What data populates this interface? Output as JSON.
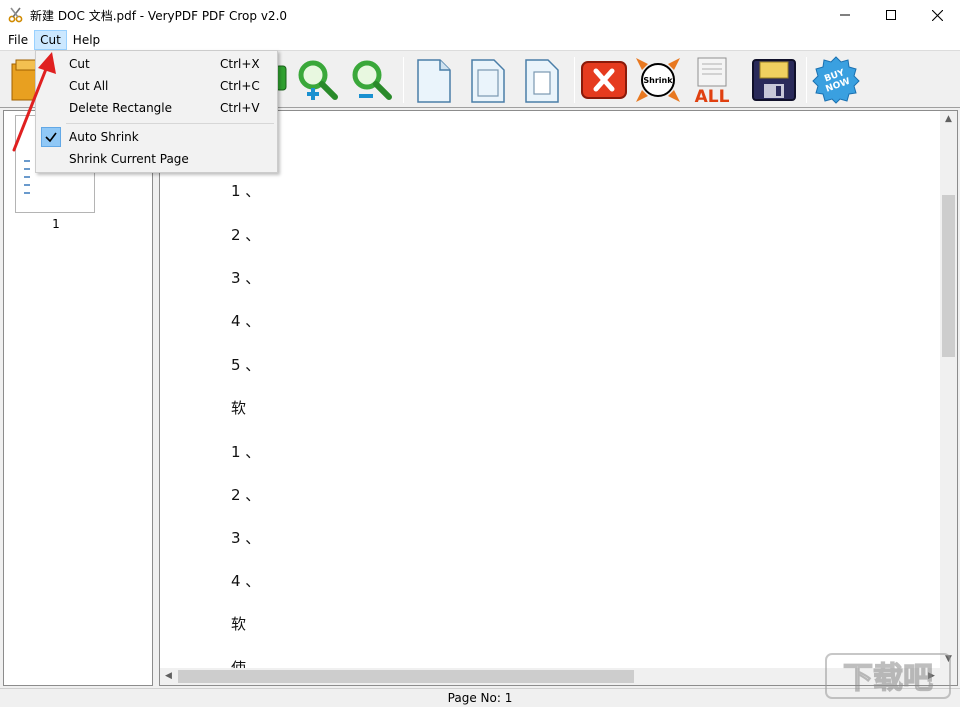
{
  "window": {
    "title": "新建 DOC 文档.pdf - VeryPDF PDF Crop v2.0",
    "app_icon": "scissors-icon",
    "controls": [
      "minimize-icon",
      "maximize-icon",
      "close-icon"
    ]
  },
  "menubar": {
    "items": [
      {
        "label": "File"
      },
      {
        "label": "Cut"
      },
      {
        "label": "Help"
      }
    ]
  },
  "cut_menu": {
    "items": [
      {
        "label": "Cut",
        "shortcut": "Ctrl+X"
      },
      {
        "label": "Cut All",
        "shortcut": "Ctrl+C"
      },
      {
        "label": "Delete Rectangle",
        "shortcut": "Ctrl+V"
      },
      {
        "label": "Auto Shrink",
        "checked": true
      },
      {
        "label": "Shrink Current Page"
      }
    ]
  },
  "toolbar": {
    "buttons": [
      "open-icon",
      "zoom-in-icon",
      "zoom-out-icon",
      "page-icon",
      "page-frame-icon",
      "page-crop-icon",
      "delete-icon",
      "shrink-icon",
      "all-icon",
      "save-icon",
      "buy-now-icon"
    ],
    "shrink_label": "Shrink",
    "all_label": "ALL",
    "buy_label_1": "BUY",
    "buy_label_2": "NOW"
  },
  "thumbnails": {
    "pages": [
      {
        "label": "1"
      }
    ]
  },
  "document": {
    "lines": [
      "1 、",
      "2 、",
      "3 、",
      "4 、",
      "5 、",
      "软",
      "1 、",
      "2 、",
      "3 、",
      "4 、",
      "软",
      "使"
    ]
  },
  "status": {
    "page_no": "Page No: 1"
  },
  "colors": {
    "menu_highlight": "#cce8ff",
    "check_bg": "#90c8f6",
    "annotation_arrow": "#e02020"
  },
  "watermark": "下载吧"
}
